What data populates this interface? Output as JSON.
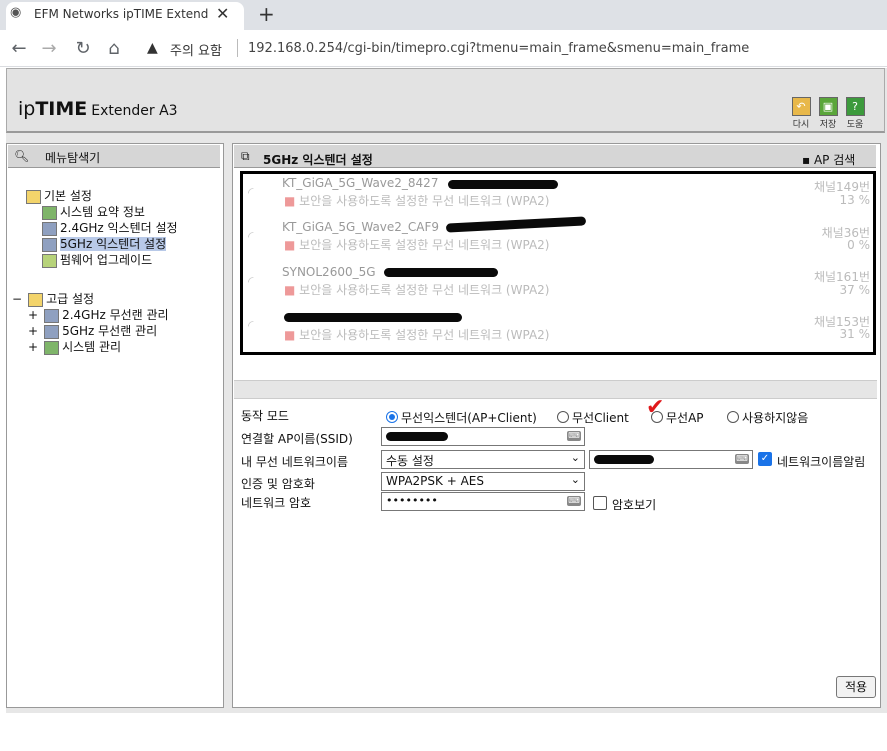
{
  "browser": {
    "tab_title": "EFM Networks ipTIME Extender",
    "close_glyph": "✕",
    "new_tab_glyph": "+",
    "warning_text": "주의 요함",
    "url": "192.168.0.254/cgi-bin/timepro.cgi?tmenu=main_frame&smenu=main_frame"
  },
  "header": {
    "logo_ip": "ip",
    "logo_time": "TIME",
    "logo_model": "Extender A3",
    "buttons": [
      {
        "label": "다시",
        "color": "#e8b84a"
      },
      {
        "label": "저장",
        "color": "#5aa63a"
      },
      {
        "label": "도움",
        "color": "#3c9a3c",
        "glyph": "?"
      }
    ]
  },
  "sidebar": {
    "title": "메뉴탐색기",
    "groups": [
      {
        "label": "기본 설정",
        "items": [
          "시스템 요약 정보",
          "2.4GHz 익스텐더 설정",
          "5GHz 익스텐더 설정",
          "펌웨어 업그레이드"
        ]
      },
      {
        "label": "고급 설정",
        "items": [
          "2.4GHz 무선랜 관리",
          "5GHz 무선랜 관리",
          "시스템 관리"
        ]
      }
    ],
    "collapse_glyph": "−",
    "expand_glyph": "+"
  },
  "main": {
    "title": "5GHz 익스텐더 설정",
    "scan_label": "AP 검색",
    "ap_list": [
      {
        "ssid": "KT_GiGA_5G_Wave2_8427",
        "security": "보안을 사용하도록 설정한 무선 네트워크 (WPA2)",
        "channel": "채널149번",
        "signal": "13 %"
      },
      {
        "ssid": "KT_GiGA_5G_Wave2_CAF9",
        "security": "보안을 사용하도록 설정한 무선 네트워크 (WPA2)",
        "channel": "채널36번",
        "signal": "0 %"
      },
      {
        "ssid": "SYNOL2600_5G",
        "security": "보안을 사용하도록 설정한 무선 네트워크 (WPA2)",
        "channel": "채널161번",
        "signal": "37 %"
      },
      {
        "ssid": "",
        "security": "보안을 사용하도록 설정한 무선 네트워크 (WPA2)",
        "channel": "채널153번",
        "signal": "31 %"
      }
    ],
    "form": {
      "mode_label": "동작 모드",
      "mode_options": [
        "무선익스텐더(AP+Client)",
        "무선Client",
        "무선AP",
        "사용하지않음"
      ],
      "ssid_label": "연결할 AP이름(SSID)",
      "mynet_label": "내 무선 네트워크이름",
      "mynet_select": "수동 설정",
      "broadcast_label": "네트워크이름알림",
      "auth_label": "인증 및 암호화",
      "auth_select": "WPA2PSK + AES",
      "pw_label": "네트워크 암호",
      "pw_value": "••••••••",
      "show_pw_label": "암호보기"
    },
    "apply_label": "적용",
    "annotation_mark": "✔"
  }
}
